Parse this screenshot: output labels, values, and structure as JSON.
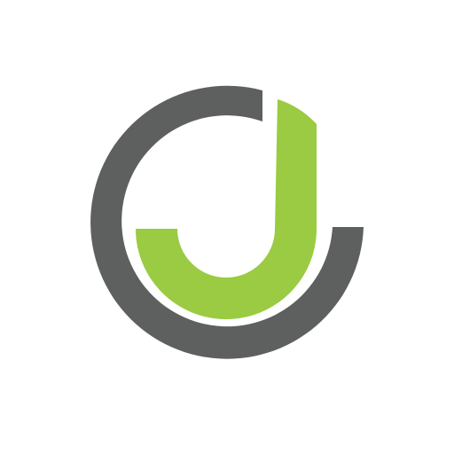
{
  "logo": {
    "name": "J circle logo",
    "icon": "j-letter-circle-logo",
    "colors": {
      "background": "#ffffff",
      "ring": "#5e5f5f",
      "letter": "#9acb42"
    }
  }
}
